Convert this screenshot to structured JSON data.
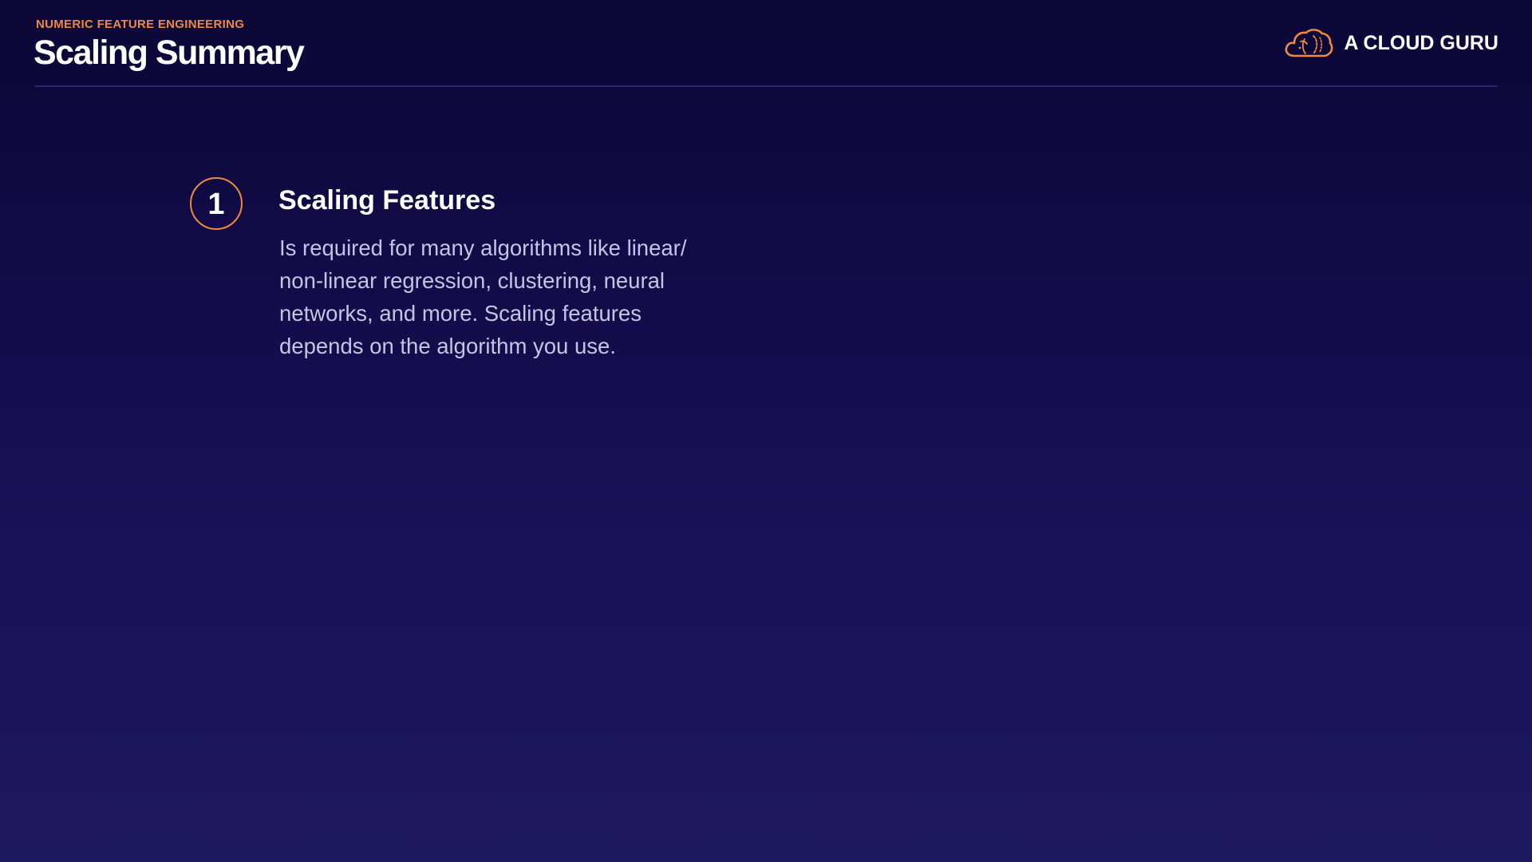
{
  "header": {
    "eyebrow": "NUMERIC FEATURE ENGINEERING",
    "title": "Scaling Summary",
    "brand_name": "A CLOUD GURU",
    "brand_icon": "cloud-logo-icon"
  },
  "colors": {
    "accent": "#f0883e",
    "background_top": "#0b0736",
    "background_bottom": "#1e185f",
    "body_text": "#c8c3e3"
  },
  "items": [
    {
      "number": "1",
      "title": "Scaling Features",
      "body": "Is required for many algorithms like linear/ non-linear regression, clustering, neural networks, and more. Scaling features depends on the algorithm you use."
    }
  ]
}
